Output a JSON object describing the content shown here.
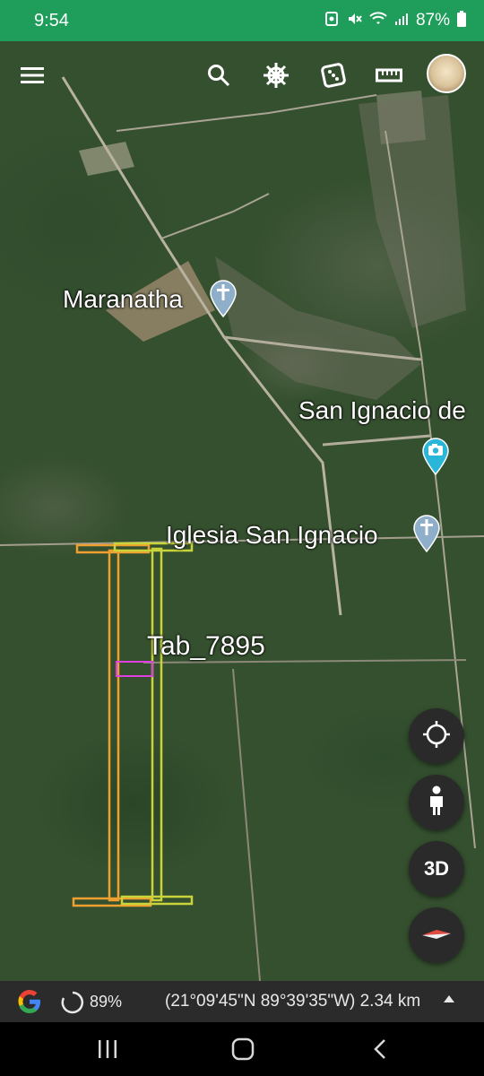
{
  "status_bar": {
    "time": "9:54",
    "battery": "87%",
    "icons": [
      "nfc-icon",
      "mute-icon",
      "wifi-icon",
      "signal-icon",
      "battery-icon"
    ]
  },
  "toolbar": {
    "icons": [
      "menu-icon",
      "search-icon",
      "voyager-wheel-icon",
      "feeling-lucky-dice-icon",
      "measure-ruler-icon",
      "profile-avatar"
    ]
  },
  "map": {
    "places": [
      {
        "name": "Maranatha",
        "icon": "church-pin-icon"
      },
      {
        "name": "San Ignacio de",
        "icon": "photo-pin-icon"
      },
      {
        "name": "Iglesia San Ignacio",
        "icon": "church-pin-icon"
      }
    ],
    "plot_label": "Tab_7895",
    "colors": {
      "orange_parcel": "#f0a030",
      "yellow_parcel": "#c9d43a",
      "magenta_marker": "#e040e0",
      "pin_blue": "#8eaec9",
      "photo_pin": "#29b6d8"
    }
  },
  "map_controls": {
    "view_3d_label": "3D",
    "icons": [
      "my-location-icon",
      "street-view-pegman-icon",
      "compass-icon"
    ]
  },
  "bottom_bar": {
    "loading_percent": "89%",
    "coordinates": "(21°09'45\"N 89°39'35\"W) 2.34 km",
    "expand_icon": "chevron-up-icon"
  },
  "nav_bar": {
    "icons": [
      "recent-apps-icon",
      "home-icon",
      "back-icon"
    ]
  }
}
